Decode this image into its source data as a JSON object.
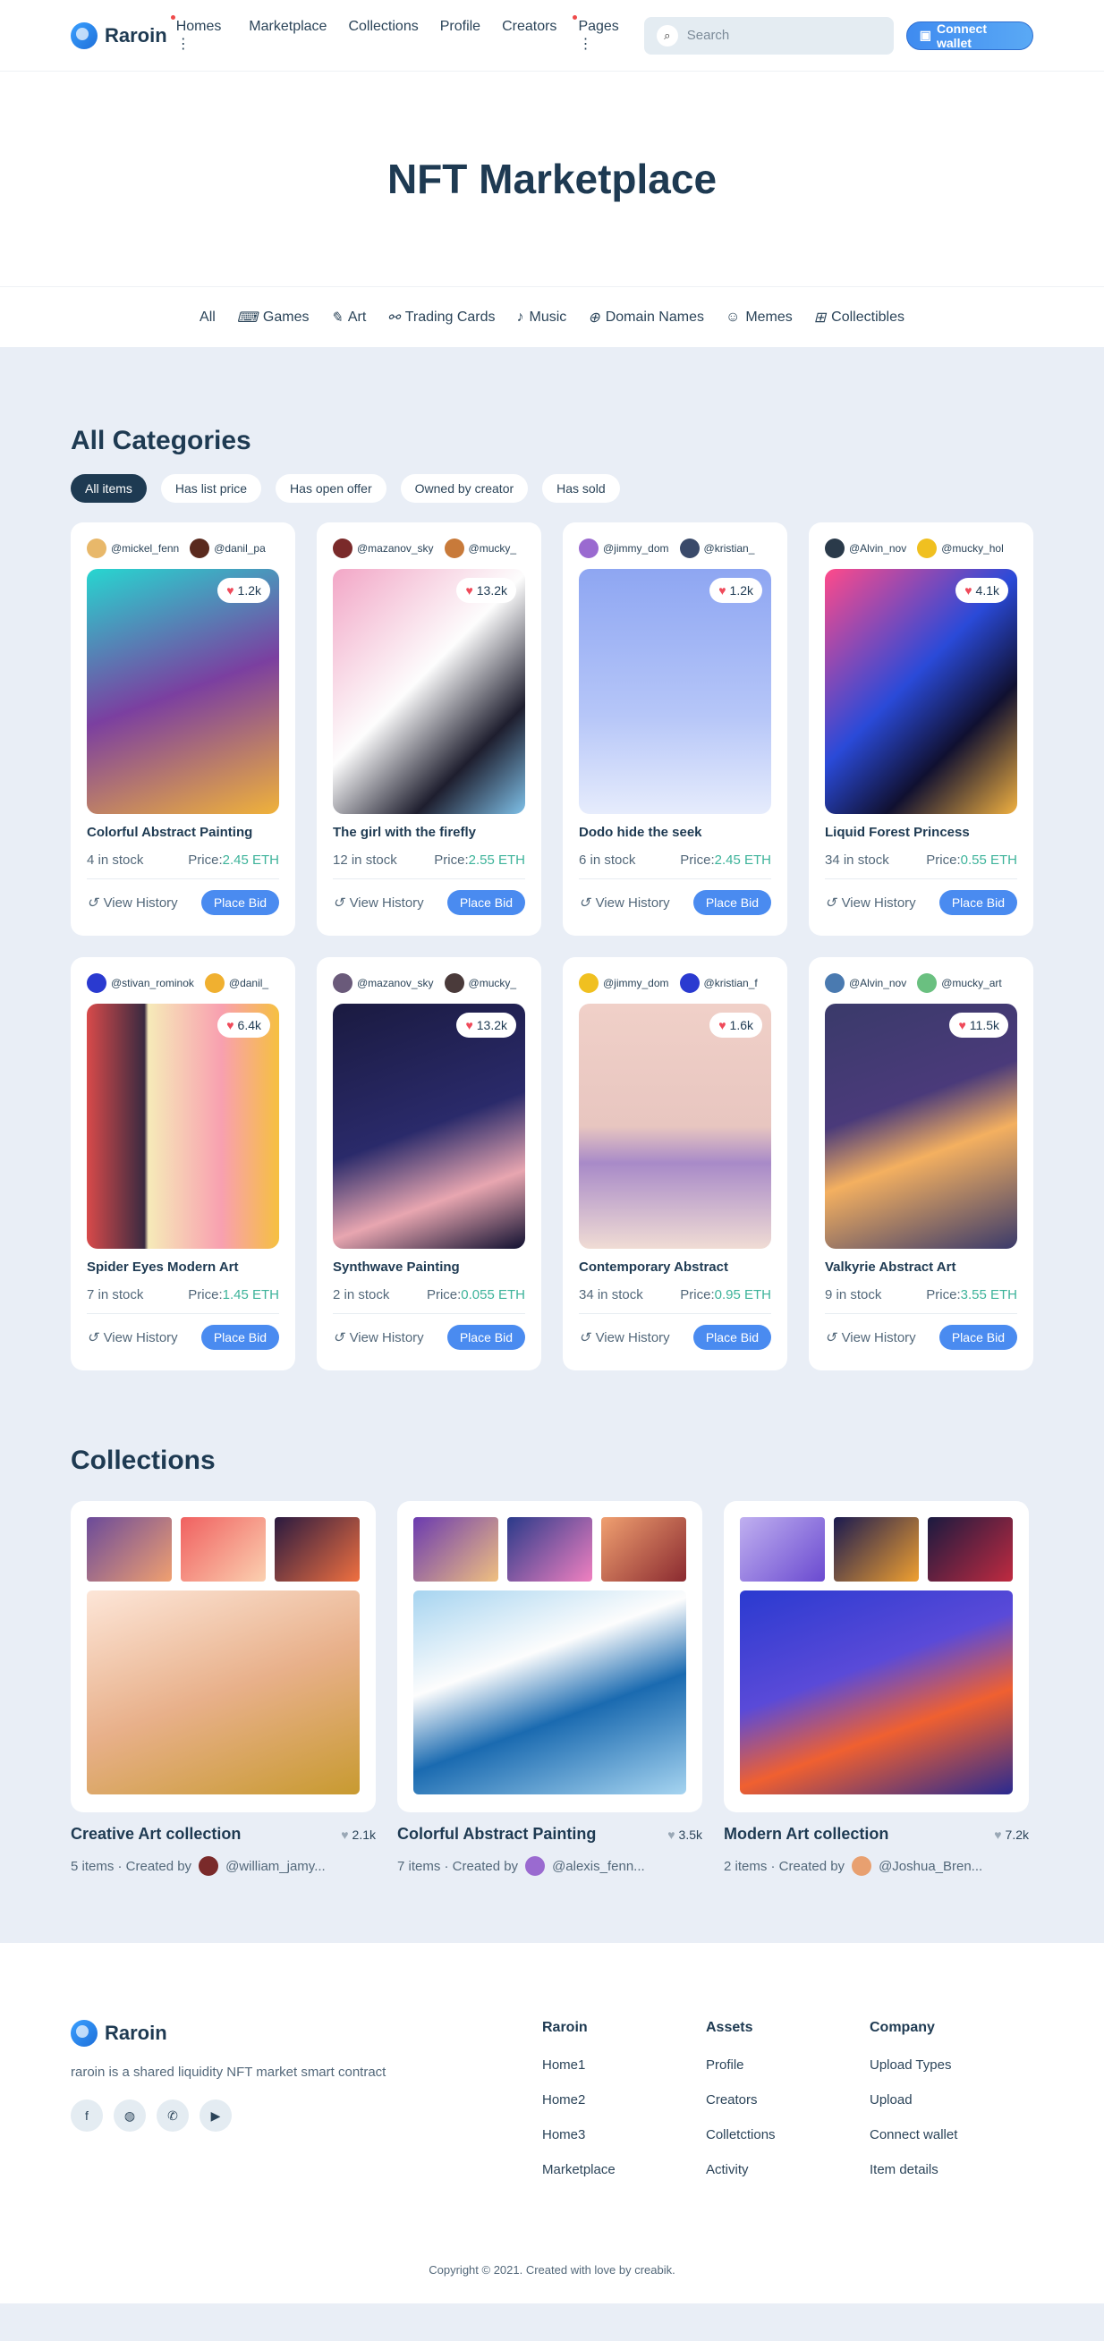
{
  "header": {
    "brand": "Raroin",
    "nav": [
      "Homes ⋮",
      "Marketplace",
      "Collections",
      "Profile",
      "Creators",
      "Pages ⋮"
    ],
    "search_placeholder": "Search",
    "connect_label": "Connect wallet"
  },
  "hero": {
    "title": "NFT Marketplace"
  },
  "categories": [
    "All",
    "Games",
    "Art",
    "Trading Cards",
    "Music",
    "Domain Names",
    "Memes",
    "Collectibles"
  ],
  "all_categories": {
    "title": "All Categories",
    "filters": [
      "All items",
      "Has list price",
      "Has open offer",
      "Owned by creator",
      "Has sold"
    ],
    "items": [
      {
        "c1": "@mickel_fenn",
        "c2": "@danil_pa",
        "likes": "1.2k",
        "title": "Colorful Abstract Painting",
        "stock": "4 in stock",
        "price": "2.45 ETH",
        "g": "linear-gradient(160deg,#27d6d0 0%,#7b3fa0 50%,#f0b23a 100%)",
        "a1": "#e8b86a",
        "a2": "#5a2a1e"
      },
      {
        "c1": "@mazanov_sky",
        "c2": "@mucky_",
        "likes": "13.2k",
        "title": "The girl with the firefly",
        "stock": "12 in stock",
        "price": "2.55 ETH",
        "g": "linear-gradient(135deg,#f2a6c6 0%,#fdfdfd 45%,#1e1e2e 75%,#7ec0e8 100%)",
        "a1": "#7a2a2a",
        "a2": "#c87a3a"
      },
      {
        "c1": "@jimmy_dom",
        "c2": "@kristian_",
        "likes": "1.2k",
        "title": "Dodo hide the seek",
        "stock": "6 in stock",
        "price": "2.45 ETH",
        "g": "linear-gradient(180deg,#8ea6f2 0%,#b6c6f8 60%,#e6ecfc 100%)",
        "a1": "#9a6ad0",
        "a2": "#3a4a6a"
      },
      {
        "c1": "@Alvin_nov",
        "c2": "@mucky_hol",
        "likes": "4.1k",
        "title": "Liquid Forest Princess",
        "stock": "34 in stock",
        "price": "0.55 ETH",
        "g": "linear-gradient(135deg,#ff4a8a 0%,#2a4ad8 45%,#101030 70%,#f0b040 100%)",
        "a1": "#2a3a4a",
        "a2": "#f0c020"
      }
    ],
    "items2": [
      {
        "c1": "@stivan_rominok",
        "c2": "@danil_",
        "likes": "6.4k",
        "title": "Spider Eyes Modern Art",
        "stock": "7 in stock",
        "price": "1.45 ETH",
        "g": "linear-gradient(90deg,#d84a4a 0%,#3a2a40 30%,#f6eab8 32%,#f8a0b0 70%,#f6c040 100%)",
        "a1": "#2a3ad0",
        "a2": "#f0b030"
      },
      {
        "c1": "@mazanov_sky",
        "c2": "@mucky_",
        "likes": "13.2k",
        "title": "Synthwave Painting",
        "stock": "2 in stock",
        "price": "0.055 ETH",
        "g": "linear-gradient(160deg,#1a1a40 0%,#2a2a6a 50%,#e8a6b0 75%,#101030 100%)",
        "a1": "#6a5a7a",
        "a2": "#4a3a3a"
      },
      {
        "c1": "@jimmy_dom",
        "c2": "@kristian_f",
        "likes": "1.6k",
        "title": "Contemporary Abstract",
        "stock": "34 in stock",
        "price": "0.95 ETH",
        "g": "linear-gradient(180deg,#f0d0c8 0%,#e8c6c0 50%,#a88ac8 65%,#f0dcd4 100%)",
        "a1": "#f0c020",
        "a2": "#2a3ad0"
      },
      {
        "c1": "@Alvin_nov",
        "c2": "@mucky_art",
        "likes": "11.5k",
        "title": "Valkyrie Abstract Art",
        "stock": "9 in stock",
        "price": "3.55 ETH",
        "g": "linear-gradient(160deg,#3a3a6a 0%,#4a3a7a 40%,#f4b060 60%,#3a3a6a 100%)",
        "a1": "#4a7ab0",
        "a2": "#6ac080"
      }
    ],
    "view_history": "View History",
    "place_bid": "Place Bid",
    "price_prefix": "Price:"
  },
  "collections": {
    "title": "Collections",
    "items": [
      {
        "name": "Creative Art collection",
        "likes": "2.1k",
        "sub": "5 items · Created by",
        "creator": "@william_jamy...",
        "t1": "linear-gradient(135deg,#6a4a9a,#f0a070)",
        "t2": "linear-gradient(135deg,#f06060,#fbd0b0)",
        "t3": "linear-gradient(135deg,#2a1a40,#f07040)",
        "big": "linear-gradient(160deg,#fde6d8 0%,#e8b08a 50%,#c89a30 100%)",
        "av": "#7a2a2a"
      },
      {
        "name": "Colorful Abstract Painting",
        "likes": "3.5k",
        "sub": "7 items · Created by",
        "creator": "@alexis_fenn...",
        "t1": "linear-gradient(135deg,#6a3ab0,#f0c080)",
        "t2": "linear-gradient(135deg,#2a3a8a,#f080c0)",
        "t3": "linear-gradient(135deg,#f0a070,#8a2a30)",
        "big": "linear-gradient(160deg,#a6d4f0 0%,#fdfdfd 35%,#1a6ab0 60%,#a6d4f0 100%)",
        "av": "#9a6ad0"
      },
      {
        "name": "Modern Art collection",
        "likes": "7.2k",
        "sub": "2 items · Created by",
        "creator": "@Joshua_Bren...",
        "t1": "linear-gradient(135deg,#c0b0f0,#6a4ad0)",
        "t2": "linear-gradient(135deg,#1a1a50,#f0a030)",
        "t3": "linear-gradient(135deg,#1a1a40,#c02a40)",
        "big": "linear-gradient(160deg,#2a3ad0 0%,#5a4ad8 40%,#f06030 65%,#2a2a90 100%)",
        "av": "#e8a070"
      }
    ]
  },
  "footer": {
    "brand": "Raroin",
    "desc": "raroin is a shared liquidity NFT market smart contract",
    "cols": [
      {
        "title": "Raroin",
        "links": [
          "Home1",
          "Home2",
          "Home3",
          "Marketplace"
        ]
      },
      {
        "title": "Assets",
        "links": [
          "Profile",
          "Creators",
          "Colletctions",
          "Activity"
        ]
      },
      {
        "title": "Company",
        "links": [
          "Upload Types",
          "Upload",
          "Connect wallet",
          "Item details"
        ]
      }
    ],
    "copyright": "Copyright © 2021. Created with love by creabik."
  }
}
